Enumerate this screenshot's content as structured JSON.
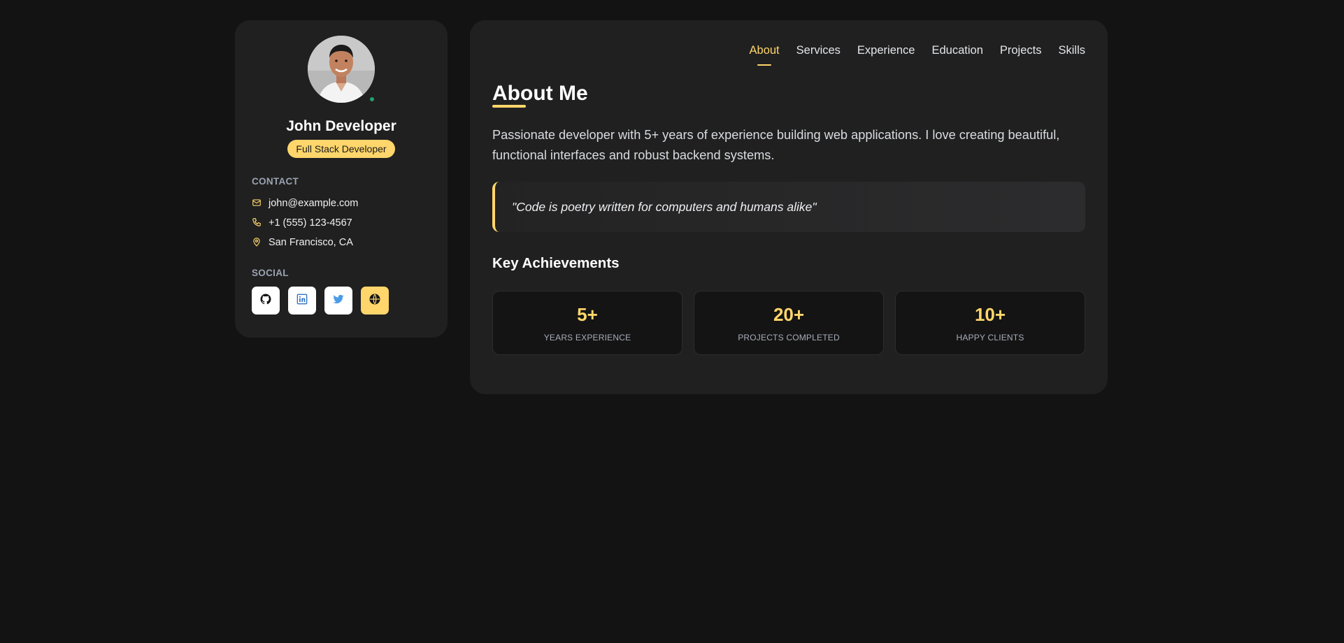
{
  "profile": {
    "name": "John Developer",
    "role": "Full Stack Developer",
    "status": "online"
  },
  "contact": {
    "title": "CONTACT",
    "items": [
      {
        "icon": "mail-icon",
        "text": "john@example.com"
      },
      {
        "icon": "phone-icon",
        "text": "+1 (555) 123-4567"
      },
      {
        "icon": "map-pin-icon",
        "text": "San Francisco, CA"
      }
    ]
  },
  "social": {
    "title": "SOCIAL",
    "items": [
      {
        "icon": "github-icon"
      },
      {
        "icon": "linkedin-icon"
      },
      {
        "icon": "twitter-icon"
      },
      {
        "icon": "globe-icon"
      }
    ]
  },
  "nav": {
    "items": [
      "About",
      "Services",
      "Experience",
      "Education",
      "Projects",
      "Skills"
    ],
    "active": "About"
  },
  "about": {
    "title": "About Me",
    "intro": "Passionate developer with 5+ years of experience building web applications. I love creating beautiful, functional interfaces and robust backend systems.",
    "quote": "\"Code is poetry written for computers and humans alike\""
  },
  "achievements": {
    "title": "Key Achievements",
    "items": [
      {
        "value": "5+",
        "label": "YEARS EXPERIENCE"
      },
      {
        "value": "20+",
        "label": "PROJECTS COMPLETED"
      },
      {
        "value": "10+",
        "label": "HAPPY CLIENTS"
      }
    ]
  },
  "colors": {
    "accent": "#ffd66b",
    "background": "#131313",
    "card": "#202020",
    "online": "#22a06b"
  }
}
